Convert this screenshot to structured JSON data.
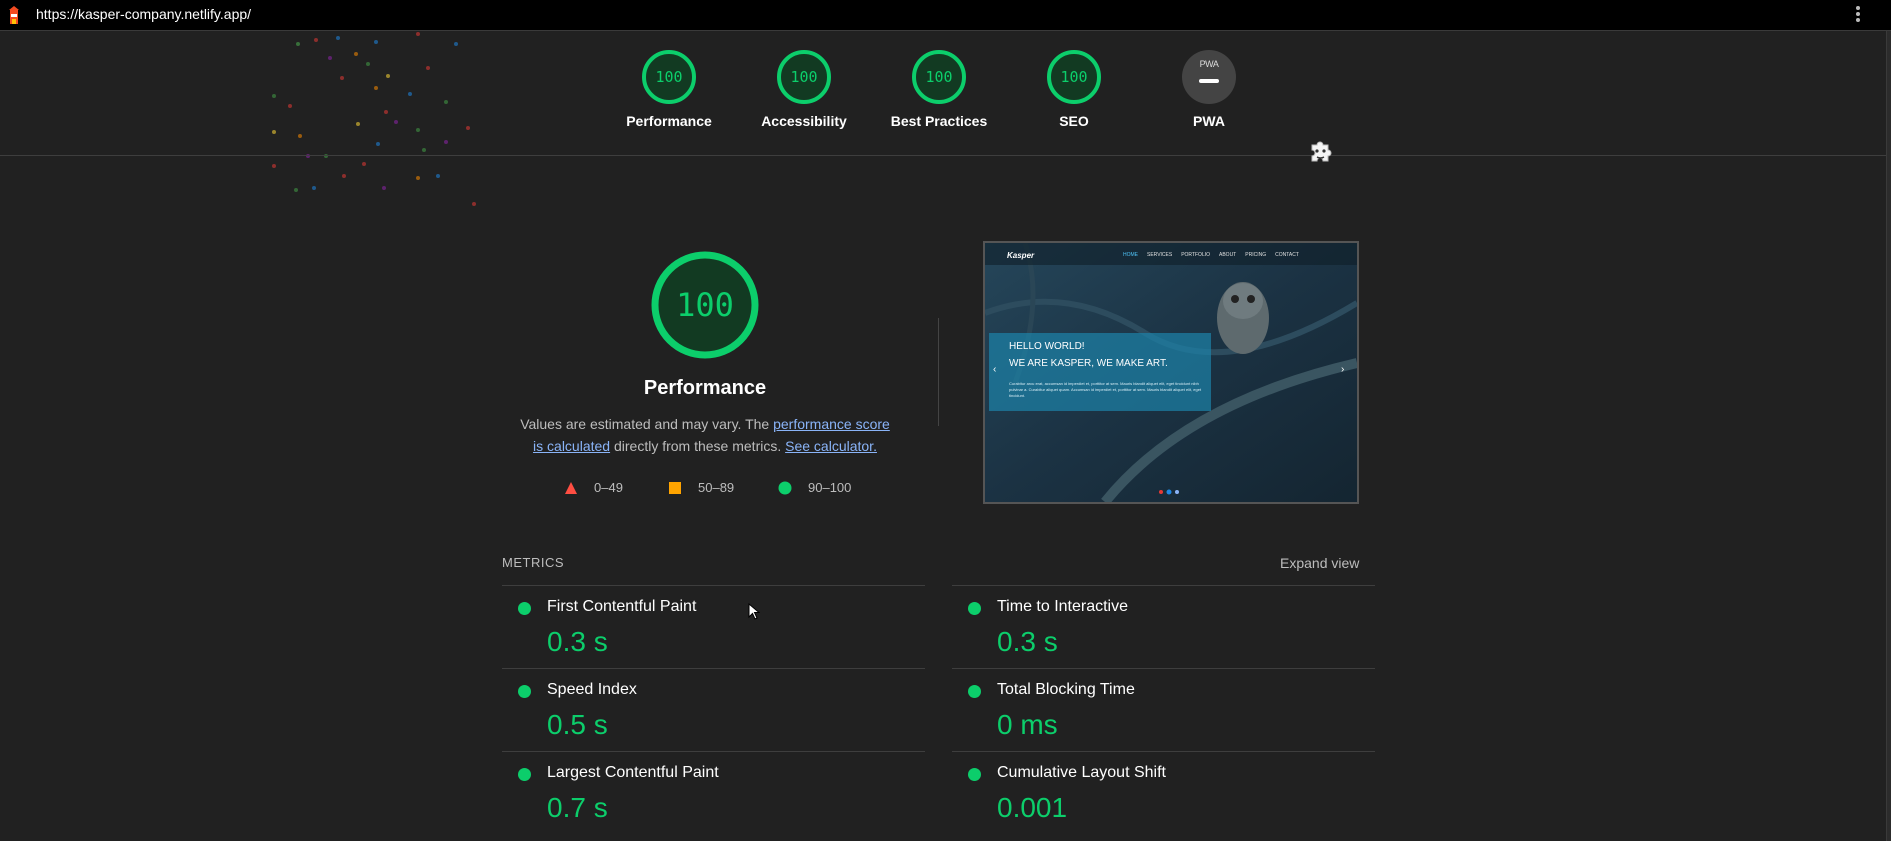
{
  "address_bar": {
    "url": "https://kasper-company.netlify.app/"
  },
  "categories": [
    {
      "label": "Performance",
      "score": "100"
    },
    {
      "label": "Accessibility",
      "score": "100"
    },
    {
      "label": "Best Practices",
      "score": "100"
    },
    {
      "label": "SEO",
      "score": "100"
    },
    {
      "label": "PWA",
      "score": "—",
      "badge_text": "PWA"
    }
  ],
  "performance": {
    "score": "100",
    "title": "Performance",
    "desc_prefix": "Values are estimated and may vary. The ",
    "desc_link": "performance score is calculated",
    "desc_middle": " directly from these metrics. ",
    "desc_calc_link": "See calculator.",
    "legend": [
      {
        "range": "0–49",
        "icon": "red-triangle-icon"
      },
      {
        "range": "50–89",
        "icon": "orange-square-icon"
      },
      {
        "range": "90–100",
        "icon": "green-circle-icon"
      }
    ]
  },
  "screenshot": {
    "brand": "Kasper",
    "nav": [
      "HOME",
      "SERVICES",
      "PORTFOLIO",
      "ABOUT",
      "PRICING",
      "CONTACT"
    ],
    "hero_line1": "HELLO WORLD!",
    "hero_line2": "WE ARE KASPER, WE MAKE ART.",
    "hero_body": "Curabitur arcu erat, accumsan id imperdiet et, porttitor at sem. Mauris blandit aliquet elit, eget tincidunt nibh pulvinar a. Curabitur aliquet quam. Accumsan id imperdiet et, porttitor at sem. Mauris blandit aliquet elit, eget tincidunt."
  },
  "metrics": {
    "heading": "METRICS",
    "expand_label": "Expand view",
    "items": [
      {
        "name": "First Contentful Paint",
        "value": "0.3 s"
      },
      {
        "name": "Time to Interactive",
        "value": "0.3 s"
      },
      {
        "name": "Speed Index",
        "value": "0.5 s"
      },
      {
        "name": "Total Blocking Time",
        "value": "0 ms"
      },
      {
        "name": "Largest Contentful Paint",
        "value": "0.7 s"
      },
      {
        "name": "Cumulative Layout Shift",
        "value": "0.001"
      }
    ]
  },
  "colors": {
    "pass": "#0cce6b",
    "average": "#ffa400",
    "fail": "#ff4e42",
    "background": "#212121",
    "link": "#8ab4f8"
  }
}
